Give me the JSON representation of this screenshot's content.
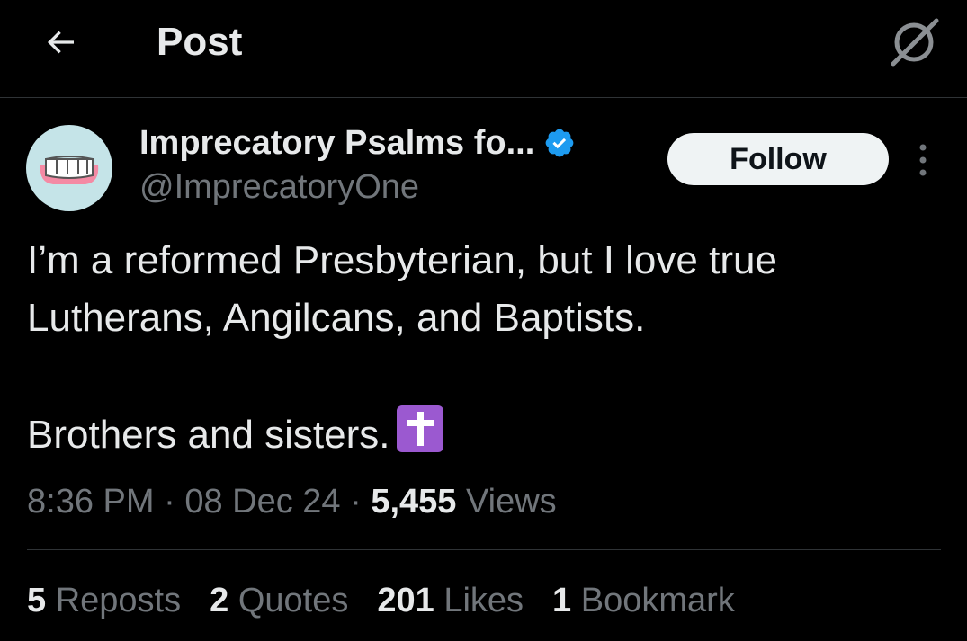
{
  "header": {
    "title": "Post",
    "back_icon": "arrow-left-icon",
    "grok_icon": "grok-icon"
  },
  "author": {
    "display_name": "Imprecatory Psalms fo...",
    "handle": "@ImprecatoryOne",
    "verified": true,
    "verified_color": "#1d9bf0",
    "avatar_bg": "#c5e4e8"
  },
  "actions": {
    "follow_label": "Follow",
    "more_icon": "more-vertical-icon"
  },
  "tweet": {
    "line1": "I’m a reformed Presbyterian, but I love true Lutherans, Angilcans, and Baptists.",
    "line2": "Brothers and sisters.",
    "emoji": "latin-cross-emoji"
  },
  "meta": {
    "time": "8:36 PM",
    "sep1": "·",
    "date": "08 Dec 24",
    "sep2": "·",
    "views_count": "5,455",
    "views_label": "Views"
  },
  "stats": {
    "reposts_count": "5",
    "reposts_label": "Reposts",
    "quotes_count": "2",
    "quotes_label": "Quotes",
    "likes_count": "201",
    "likes_label": "Likes",
    "bookmarks_count": "1",
    "bookmarks_label": "Bookmark"
  },
  "colors": {
    "background": "#000000",
    "text_primary": "#e7e9ea",
    "text_secondary": "#71767b",
    "border": "#2f3336",
    "emoji_purple": "#9b59d0"
  }
}
